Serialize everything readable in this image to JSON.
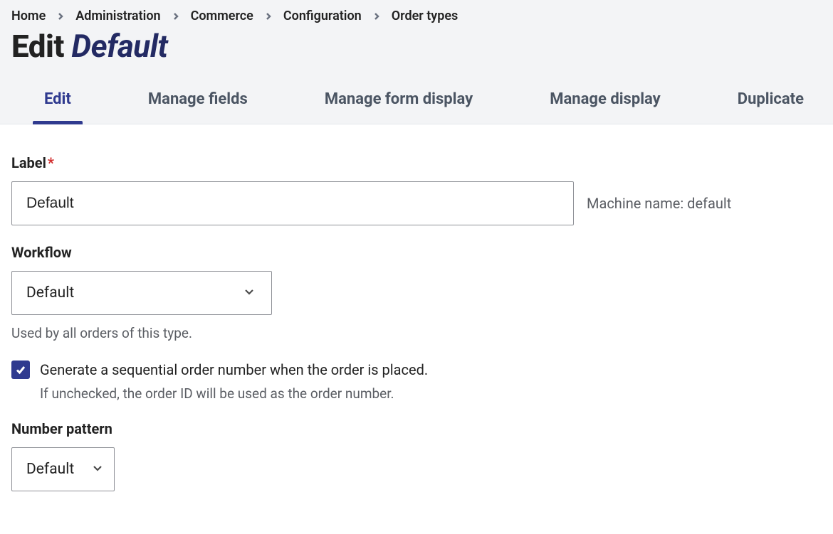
{
  "breadcrumb": {
    "items": [
      {
        "label": "Home"
      },
      {
        "label": "Administration"
      },
      {
        "label": "Commerce"
      },
      {
        "label": "Configuration"
      },
      {
        "label": "Order types"
      }
    ]
  },
  "page_title": {
    "prefix": "Edit ",
    "entity": "Default"
  },
  "tabs": [
    {
      "label": "Edit",
      "active": true
    },
    {
      "label": "Manage fields",
      "active": false
    },
    {
      "label": "Manage form display",
      "active": false
    },
    {
      "label": "Manage display",
      "active": false
    },
    {
      "label": "Duplicate",
      "active": false
    }
  ],
  "form": {
    "label": {
      "title": "Label",
      "required_mark": "*",
      "value": "Default",
      "machine_name_prefix": "Machine name: ",
      "machine_name_value": "default"
    },
    "workflow": {
      "title": "Workflow",
      "value": "Default",
      "description": "Used by all orders of this type."
    },
    "sequential": {
      "checked": true,
      "label": "Generate a sequential order number when the order is placed.",
      "description": "If unchecked, the order ID will be used as the order number."
    },
    "number_pattern": {
      "title": "Number pattern",
      "value": "Default"
    }
  }
}
